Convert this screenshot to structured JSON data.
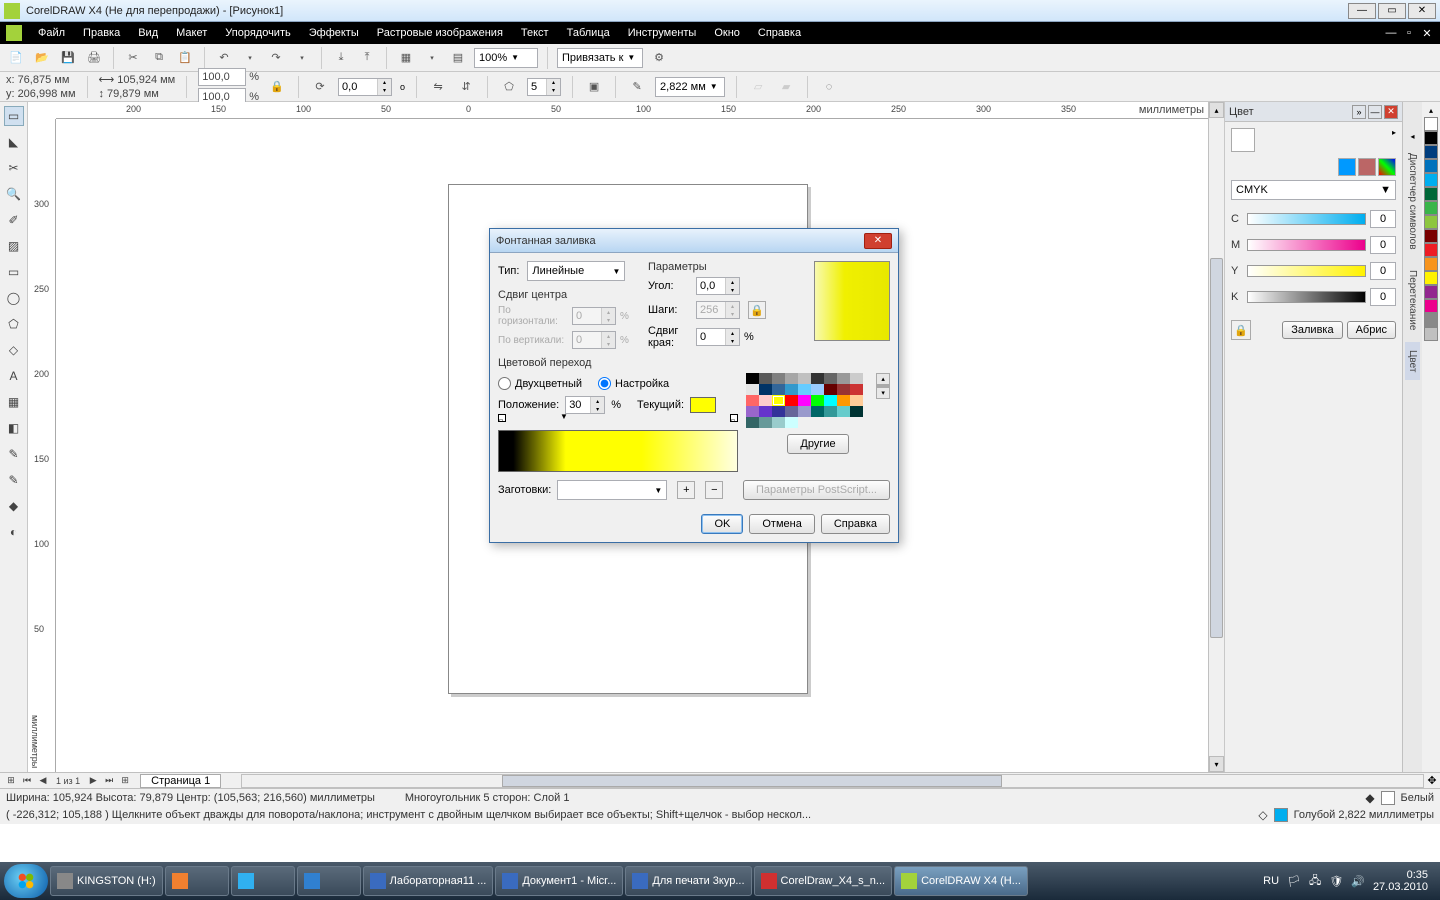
{
  "window": {
    "title": "CorelDRAW X4 (Не для перепродажи) - [Рисунок1]"
  },
  "menu": [
    "Файл",
    "Правка",
    "Вид",
    "Макет",
    "Упорядочить",
    "Эффекты",
    "Растровые изображения",
    "Текст",
    "Таблица",
    "Инструменты",
    "Окно",
    "Справка"
  ],
  "toolbar": {
    "zoom": "100%",
    "snap_label": "Привязать к"
  },
  "props": {
    "x": "76,875 мм",
    "y": "206,998 мм",
    "w": "105,924 мм",
    "h": "79,879 мм",
    "sx": "100,0",
    "sy": "100,0",
    "angle": "0,0",
    "sides": "5",
    "outline": "2,822 мм"
  },
  "ruler": {
    "unit": "миллиметры",
    "hticks": [
      "200",
      "150",
      "100",
      "50",
      "0",
      "50",
      "100",
      "150",
      "200",
      "250",
      "300",
      "350"
    ],
    "vticks": [
      "300",
      "250",
      "200",
      "150",
      "100",
      "50"
    ]
  },
  "rightpanel": {
    "title": "Цвет",
    "model": "CMYK",
    "c": "0",
    "m": "0",
    "y": "0",
    "k": "0",
    "fill_btn": "Заливка",
    "outline_btn": "Абрис",
    "vtabs": [
      "Диспетчер символов",
      "Перетекание",
      "Цвет"
    ]
  },
  "palette_colors": [
    "#ffffff",
    "#000000",
    "#003e7e",
    "#0072bc",
    "#00aeef",
    "#006838",
    "#39b54a",
    "#8dc63f",
    "#790000",
    "#ed1c24",
    "#f7941d",
    "#fff200",
    "#92278f",
    "#ec008c",
    "#898989",
    "#c0c0c0"
  ],
  "dialog": {
    "title": "Фонтанная заливка",
    "type_label": "Тип:",
    "type_value": "Линейные",
    "center_shift": "Сдвиг центра",
    "horiz": "По горизонтали:",
    "vert": "По вертикали:",
    "horiz_v": "0",
    "vert_v": "0",
    "params": "Параметры",
    "angle": "Угол:",
    "angle_v": "0,0",
    "steps": "Шаги:",
    "steps_v": "256",
    "edge": "Сдвиг края:",
    "edge_v": "0",
    "color_blend": "Цветовой переход",
    "two_color": "Двухцветный",
    "custom": "Настройка",
    "position": "Положение:",
    "position_v": "30",
    "current": "Текущий:",
    "others": "Другие",
    "presets": "Заготовки:",
    "postscript": "Параметры PostScript...",
    "ok": "OK",
    "cancel": "Отмена",
    "help": "Справка",
    "palette": [
      "#000000",
      "#595959",
      "#808080",
      "#a6a6a6",
      "#c0c0c0",
      "#333333",
      "#666666",
      "#999999",
      "#cccccc",
      "#e6e6e6",
      "#003366",
      "#336699",
      "#3399cc",
      "#66ccff",
      "#99ccff",
      "#660000",
      "#993333",
      "#cc3333",
      "#ff6666",
      "#ffcccc",
      "#ffff00",
      "#ff0000",
      "#ff00ff",
      "#00ff00",
      "#00ffff",
      "#ff9900",
      "#ffcc99",
      "#9966cc",
      "#6633cc",
      "#333399",
      "#666699",
      "#9999cc",
      "#006666",
      "#339999",
      "#66cccc",
      "#003333",
      "#336666",
      "#669999",
      "#99cccc",
      "#ccffff"
    ]
  },
  "pagebar": {
    "pages": "1 из 1",
    "tab": "Страница 1"
  },
  "status": {
    "line1_a": "Ширина: 105,924  Высота: 79,879  Центр: (105,563; 216,560)  миллиметры",
    "line1_b": "Многоугольник  5 сторон: Слой 1",
    "line2": "( -226,312;  105,188 )     Щелкните объект дважды для поворота/наклона; инструмент с двойным щелчком выбирает все объекты; Shift+щелчок - выбор нескол...",
    "fill": "Белый",
    "outline": "Голубой  2,822 миллиметры"
  },
  "taskbar": {
    "items": [
      {
        "label": "KINGSTON (H:)",
        "color": "#888"
      },
      {
        "label": "",
        "color": "#f08030"
      },
      {
        "label": "",
        "color": "#30b0f0"
      },
      {
        "label": "",
        "color": "#3080d0"
      },
      {
        "label": "Лабораторная11 ...",
        "color": "#3a6bbf"
      },
      {
        "label": "Документ1 - Micr...",
        "color": "#3a6bbf"
      },
      {
        "label": "Для печати 3кур...",
        "color": "#3a6bbf"
      },
      {
        "label": "CorelDraw_X4_s_n...",
        "color": "#d03030"
      },
      {
        "label": "CorelDRAW X4 (Н...",
        "color": "#a3d23b"
      }
    ],
    "lang": "RU",
    "time": "0:35",
    "date": "27.03.2010"
  }
}
